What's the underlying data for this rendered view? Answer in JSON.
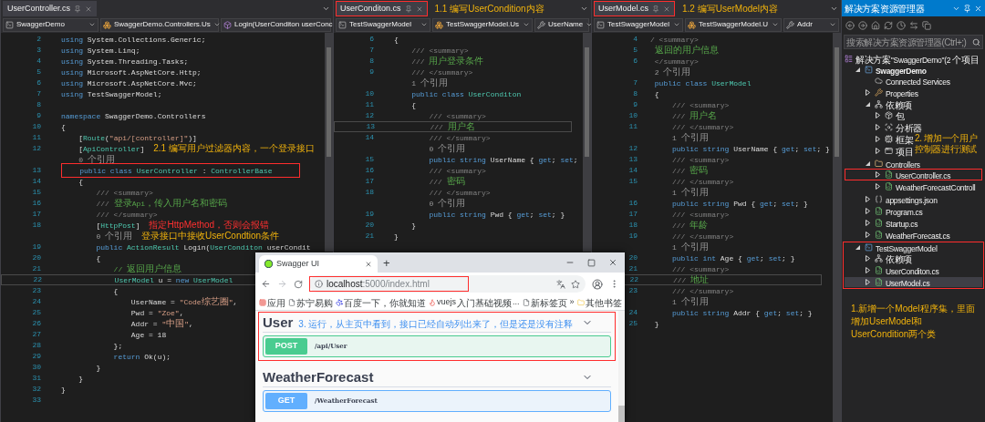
{
  "editors": [
    {
      "tab": {
        "label": "UserController.cs",
        "boxed": false
      },
      "nav": [
        {
          "label": "SwaggerDemo",
          "kind": "project"
        },
        {
          "label": "SwaggerDemo.Controllers.Us",
          "kind": "class"
        },
        {
          "label": "Login(UserConditon userConc",
          "kind": "method"
        }
      ],
      "lines": [
        {
          "kind": "code",
          "number": "2",
          "tokens": [
            {
              "kind": "kw",
              "text": "using"
            },
            {
              "kind": "plain",
              "text": " System.Collections.Generic;"
            }
          ]
        },
        {
          "kind": "code",
          "number": "3",
          "tokens": [
            {
              "kind": "kw",
              "text": "using"
            },
            {
              "kind": "plain",
              "text": " System.Linq;"
            }
          ]
        },
        {
          "kind": "code",
          "number": "4",
          "tokens": [
            {
              "kind": "kw",
              "text": "using"
            },
            {
              "kind": "plain",
              "text": " System.Threading.Tasks;"
            }
          ]
        },
        {
          "kind": "code",
          "number": "5",
          "tokens": [
            {
              "kind": "kw",
              "text": "using"
            },
            {
              "kind": "plain",
              "text": " Microsoft.AspNetCore.Http;"
            }
          ]
        },
        {
          "kind": "code",
          "number": "6",
          "tokens": [
            {
              "kind": "kw",
              "text": "using"
            },
            {
              "kind": "plain",
              "text": " Microsoft.AspNetCore.Mvc;"
            }
          ]
        },
        {
          "kind": "code",
          "number": "7",
          "tokens": [
            {
              "kind": "kw",
              "text": "using"
            },
            {
              "kind": "plain",
              "text": " TestSwaggerModel;"
            }
          ]
        },
        {
          "kind": "code",
          "number": "8"
        },
        {
          "kind": "code",
          "number": "9",
          "tokens": [
            {
              "kind": "kw",
              "text": "namespace"
            },
            {
              "kind": "plain",
              "text": " SwaggerDemo.Controllers"
            }
          ]
        },
        {
          "kind": "code",
          "number": "10",
          "tokens": [
            {
              "kind": "plain",
              "text": "{"
            }
          ]
        },
        {
          "kind": "code",
          "number": "11",
          "tokens": [
            {
              "kind": "plain",
              "text": "    ["
            },
            {
              "kind": "type",
              "text": "Route"
            },
            {
              "kind": "plain",
              "text": "("
            },
            {
              "kind": "str",
              "text": "\"api/[controller]\""
            },
            {
              "kind": "plain",
              "text": ")]"
            }
          ]
        },
        {
          "kind": "code",
          "number": "12",
          "tokens": [
            {
              "kind": "plain",
              "text": "    ["
            },
            {
              "kind": "type",
              "text": "ApiController"
            },
            {
              "kind": "plain",
              "text": "]"
            }
          ],
          "note": {
            "text": "2.1 编写用户过滤器内容，一个登录接口",
            "kind": "callout"
          }
        },
        {
          "kind": "lens",
          "text": "    0 个引用"
        },
        {
          "kind": "marked",
          "number": "13",
          "tokens": [
            {
              "kind": "kw",
              "text": "    public class "
            },
            {
              "kind": "type",
              "text": "UserController"
            },
            {
              "kind": "plain",
              "text": " : "
            },
            {
              "kind": "type",
              "text": "ControllerBase"
            }
          ]
        },
        {
          "kind": "code",
          "number": "14",
          "tokens": [
            {
              "kind": "plain",
              "text": "    {"
            }
          ]
        },
        {
          "kind": "code",
          "number": "15",
          "tokens": [
            {
              "kind": "doc",
              "text": "        /// <summary>"
            }
          ]
        },
        {
          "kind": "code",
          "number": "16",
          "tokens": [
            {
              "kind": "doc",
              "text": "        ///"
            },
            {
              "kind": "comment",
              "text": " 登录Api，传入用户名和密码"
            }
          ]
        },
        {
          "kind": "code",
          "number": "17",
          "tokens": [
            {
              "kind": "doc",
              "text": "        /// </summary>"
            }
          ]
        },
        {
          "kind": "code",
          "number": "18",
          "tokens": [
            {
              "kind": "plain",
              "text": "        ["
            },
            {
              "kind": "type",
              "text": "HttpPost"
            },
            {
              "kind": "plain",
              "text": "]"
            }
          ],
          "note": {
            "text": "指定HttpMethod，否则会报错",
            "kind": "warning"
          }
        },
        {
          "kind": "lens",
          "text": "        0 个引用",
          "note": {
            "text": "登录接口中接收UserCondtion条件",
            "kind": "callout"
          }
        },
        {
          "kind": "code",
          "number": "19",
          "tokens": [
            {
              "kind": "kw",
              "text": "        public "
            },
            {
              "kind": "type",
              "text": "ActionResult"
            },
            {
              "kind": "plain",
              "text": " Login("
            },
            {
              "kind": "type",
              "text": "UserConditon"
            },
            {
              "kind": "plain",
              "text": " userCondit"
            }
          ]
        },
        {
          "kind": "code",
          "number": "20",
          "tokens": [
            {
              "kind": "plain",
              "text": "        {"
            }
          ]
        },
        {
          "kind": "code",
          "number": "21",
          "tokens": [
            {
              "kind": "comment",
              "text": "            // 返回用户信息"
            }
          ]
        },
        {
          "kind": "current",
          "number": "22",
          "tokens": [
            {
              "kind": "type",
              "text": "            UserModel"
            },
            {
              "kind": "plain",
              "text": " u = "
            },
            {
              "kind": "kw",
              "text": "new "
            },
            {
              "kind": "type",
              "text": "UserModel"
            }
          ]
        },
        {
          "kind": "code",
          "number": "23",
          "tokens": [
            {
              "kind": "plain",
              "text": "            {"
            }
          ]
        },
        {
          "kind": "code",
          "number": "24",
          "tokens": [
            {
              "kind": "plain",
              "text": "                UserName = "
            },
            {
              "kind": "str",
              "text": "\"Code综艺圈\""
            },
            {
              "kind": "plain",
              "text": ","
            }
          ]
        },
        {
          "kind": "code",
          "number": "25",
          "tokens": [
            {
              "kind": "plain",
              "text": "                Pwd = "
            },
            {
              "kind": "str",
              "text": "\"Zoe\""
            },
            {
              "kind": "plain",
              "text": ","
            }
          ]
        },
        {
          "kind": "code",
          "number": "26",
          "tokens": [
            {
              "kind": "plain",
              "text": "                Addr = "
            },
            {
              "kind": "str",
              "text": "\"中国\""
            },
            {
              "kind": "plain",
              "text": ","
            }
          ]
        },
        {
          "kind": "code",
          "number": "27",
          "tokens": [
            {
              "kind": "plain",
              "text": "                Age = 18"
            }
          ]
        },
        {
          "kind": "code",
          "number": "28",
          "tokens": [
            {
              "kind": "plain",
              "text": "            };"
            }
          ]
        },
        {
          "kind": "code",
          "number": "29",
          "tokens": [
            {
              "kind": "kw",
              "text": "            return"
            },
            {
              "kind": "plain",
              "text": " Ok(u);"
            }
          ]
        },
        {
          "kind": "code",
          "number": "30",
          "tokens": [
            {
              "kind": "plain",
              "text": "        }"
            }
          ]
        },
        {
          "kind": "code",
          "number": "31",
          "tokens": [
            {
              "kind": "plain",
              "text": "    }"
            }
          ]
        },
        {
          "kind": "code",
          "number": "32",
          "tokens": [
            {
              "kind": "plain",
              "text": "}"
            }
          ]
        },
        {
          "kind": "code",
          "number": "33"
        }
      ]
    },
    {
      "tab": {
        "label": "UserConditon.cs",
        "boxed": true,
        "note": {
          "text": "1.1 编写UserCondition内容",
          "kind": "callout"
        }
      },
      "nav": [
        {
          "label": "TestSwaggerModel",
          "kind": "project"
        },
        {
          "label": "TestSwaggerModel.Us",
          "kind": "class"
        },
        {
          "label": "UserName",
          "kind": "property"
        }
      ],
      "lines": [
        {
          "kind": "code",
          "number": "6",
          "tokens": [
            {
              "kind": "plain",
              "text": "{"
            }
          ]
        },
        {
          "kind": "code",
          "number": "7",
          "tokens": [
            {
              "kind": "doc",
              "text": "    /// <summary>"
            }
          ]
        },
        {
          "kind": "code",
          "number": "8",
          "tokens": [
            {
              "kind": "doc",
              "text": "    ///"
            },
            {
              "kind": "comment",
              "text": " 用户登录条件"
            }
          ]
        },
        {
          "kind": "code",
          "number": "9",
          "tokens": [
            {
              "kind": "doc",
              "text": "    /// </summary>"
            }
          ]
        },
        {
          "kind": "lens",
          "text": "    1 个引用"
        },
        {
          "kind": "code",
          "number": "10",
          "tokens": [
            {
              "kind": "kw",
              "text": "    public class "
            },
            {
              "kind": "type",
              "text": "UserConditon"
            }
          ]
        },
        {
          "kind": "code",
          "number": "11",
          "tokens": [
            {
              "kind": "plain",
              "text": "    {"
            }
          ]
        },
        {
          "kind": "code",
          "number": "12",
          "tokens": [
            {
              "kind": "doc",
              "text": "        /// <summary>"
            }
          ]
        },
        {
          "kind": "current",
          "number": "13",
          "tokens": [
            {
              "kind": "doc",
              "text": "        ///"
            },
            {
              "kind": "comment",
              "text": " 用户名"
            }
          ]
        },
        {
          "kind": "code",
          "number": "14",
          "tokens": [
            {
              "kind": "doc",
              "text": "        /// </summary>"
            }
          ]
        },
        {
          "kind": "lens",
          "text": "        0 个引用"
        },
        {
          "kind": "code",
          "number": "15",
          "tokens": [
            {
              "kind": "kw",
              "text": "        public string "
            },
            {
              "kind": "plain",
              "text": "UserName { "
            },
            {
              "kind": "kw",
              "text": "get"
            },
            {
              "kind": "plain",
              "text": "; "
            },
            {
              "kind": "kw",
              "text": "set"
            },
            {
              "kind": "plain",
              "text": ";"
            }
          ]
        },
        {
          "kind": "code",
          "number": "16",
          "tokens": [
            {
              "kind": "doc",
              "text": "        /// <summary>"
            }
          ]
        },
        {
          "kind": "code",
          "number": "17",
          "tokens": [
            {
              "kind": "doc",
              "text": "        ///"
            },
            {
              "kind": "comment",
              "text": " 密码"
            }
          ]
        },
        {
          "kind": "code",
          "number": "18",
          "tokens": [
            {
              "kind": "doc",
              "text": "        /// </summary>"
            }
          ]
        },
        {
          "kind": "lens",
          "text": "        0 个引用"
        },
        {
          "kind": "code",
          "number": "19",
          "tokens": [
            {
              "kind": "kw",
              "text": "        public string "
            },
            {
              "kind": "plain",
              "text": "Pwd { "
            },
            {
              "kind": "kw",
              "text": "get"
            },
            {
              "kind": "plain",
              "text": "; "
            },
            {
              "kind": "kw",
              "text": "set"
            },
            {
              "kind": "plain",
              "text": "; }"
            }
          ]
        },
        {
          "kind": "code",
          "number": "20",
          "tokens": [
            {
              "kind": "plain",
              "text": "    }"
            }
          ]
        },
        {
          "kind": "code",
          "number": "21",
          "tokens": [
            {
              "kind": "plain",
              "text": "}"
            }
          ]
        }
      ]
    },
    {
      "tab": {
        "label": "UserModel.cs",
        "boxed": true,
        "note": {
          "text": "1.2 编写UserModel内容",
          "kind": "callout"
        }
      },
      "nav": [
        {
          "label": "TestSwaggerModel",
          "kind": "project"
        },
        {
          "label": "TestSwaggerModel.U",
          "kind": "class"
        },
        {
          "label": "Addr",
          "kind": "property"
        }
      ],
      "lines": [
        {
          "kind": "code",
          "number": "4",
          "tokens": [
            {
              "kind": "doc",
              "text": "/ <summary>"
            }
          ]
        },
        {
          "kind": "code",
          "number": "5",
          "tokens": [
            {
              "kind": "comment",
              "text": " 返回的用户信息"
            }
          ]
        },
        {
          "kind": "code",
          "number": "6",
          "tokens": [
            {
              "kind": "doc",
              "text": " </summary>"
            }
          ]
        },
        {
          "kind": "lens",
          "text": " 2 个引用"
        },
        {
          "kind": "code",
          "number": "7",
          "tokens": [
            {
              "kind": "kw",
              "text": " public class "
            },
            {
              "kind": "type",
              "text": "UserModel"
            }
          ]
        },
        {
          "kind": "code",
          "number": "8",
          "tokens": [
            {
              "kind": "plain",
              "text": " {"
            }
          ]
        },
        {
          "kind": "code",
          "number": "9",
          "tokens": [
            {
              "kind": "doc",
              "text": "     /// <summary>"
            }
          ]
        },
        {
          "kind": "code",
          "number": "10",
          "tokens": [
            {
              "kind": "doc",
              "text": "     ///"
            },
            {
              "kind": "comment",
              "text": " 用户名"
            }
          ]
        },
        {
          "kind": "code",
          "number": "11",
          "tokens": [
            {
              "kind": "doc",
              "text": "     /// </summary>"
            }
          ]
        },
        {
          "kind": "lens",
          "text": "     1 个引用"
        },
        {
          "kind": "code",
          "number": "12",
          "tokens": [
            {
              "kind": "kw",
              "text": "     public string "
            },
            {
              "kind": "plain",
              "text": "UserName { "
            },
            {
              "kind": "kw",
              "text": "get"
            },
            {
              "kind": "plain",
              "text": "; "
            },
            {
              "kind": "kw",
              "text": "set"
            },
            {
              "kind": "plain",
              "text": "; }"
            }
          ]
        },
        {
          "kind": "code",
          "number": "13",
          "tokens": [
            {
              "kind": "doc",
              "text": "     /// <summary>"
            }
          ]
        },
        {
          "kind": "code",
          "number": "14",
          "tokens": [
            {
              "kind": "doc",
              "text": "     ///"
            },
            {
              "kind": "comment",
              "text": " 密码"
            }
          ]
        },
        {
          "kind": "code",
          "number": "15",
          "tokens": [
            {
              "kind": "doc",
              "text": "     /// </summary>"
            }
          ]
        },
        {
          "kind": "lens",
          "text": "     1 个引用"
        },
        {
          "kind": "code",
          "number": "16",
          "tokens": [
            {
              "kind": "kw",
              "text": "     public string "
            },
            {
              "kind": "plain",
              "text": "Pwd { "
            },
            {
              "kind": "kw",
              "text": "get"
            },
            {
              "kind": "plain",
              "text": "; "
            },
            {
              "kind": "kw",
              "text": "set"
            },
            {
              "kind": "plain",
              "text": "; }"
            }
          ]
        },
        {
          "kind": "code",
          "number": "17",
          "tokens": [
            {
              "kind": "doc",
              "text": "     /// <summary>"
            }
          ]
        },
        {
          "kind": "code",
          "number": "18",
          "tokens": [
            {
              "kind": "doc",
              "text": "     ///"
            },
            {
              "kind": "comment",
              "text": " 年龄"
            }
          ]
        },
        {
          "kind": "code",
          "number": "19",
          "tokens": [
            {
              "kind": "doc",
              "text": "     /// </summary>"
            }
          ]
        },
        {
          "kind": "lens",
          "text": "     1 个引用"
        },
        {
          "kind": "code",
          "number": "20",
          "tokens": [
            {
              "kind": "kw",
              "text": "     public int "
            },
            {
              "kind": "plain",
              "text": "Age { "
            },
            {
              "kind": "kw",
              "text": "get"
            },
            {
              "kind": "plain",
              "text": "; "
            },
            {
              "kind": "kw",
              "text": "set"
            },
            {
              "kind": "plain",
              "text": "; }"
            }
          ]
        },
        {
          "kind": "code",
          "number": "21",
          "tokens": [
            {
              "kind": "doc",
              "text": "     /// <summary>"
            }
          ]
        },
        {
          "kind": "current",
          "number": "22",
          "tokens": [
            {
              "kind": "doc",
              "text": "     ///"
            },
            {
              "kind": "comment",
              "text": " 地址"
            }
          ]
        },
        {
          "kind": "code",
          "number": "23",
          "tokens": [
            {
              "kind": "doc",
              "text": "     /// </summary>"
            }
          ]
        },
        {
          "kind": "lens",
          "text": "     1 个引用"
        },
        {
          "kind": "code",
          "number": "24",
          "tokens": [
            {
              "kind": "kw",
              "text": "     public string "
            },
            {
              "kind": "plain",
              "text": "Addr { "
            },
            {
              "kind": "kw",
              "text": "get"
            },
            {
              "kind": "plain",
              "text": "; "
            },
            {
              "kind": "kw",
              "text": "set"
            },
            {
              "kind": "plain",
              "text": "; }"
            }
          ]
        },
        {
          "kind": "code",
          "number": "25",
          "tokens": [
            {
              "kind": "plain",
              "text": " }"
            }
          ]
        }
      ]
    }
  ],
  "explorer": {
    "title": "解决方案资源管理器",
    "search": {
      "placeholder": "搜索解决方案资源管理器(Ctrl+;)"
    },
    "tree": {
      "label": "解决方案\"SwaggerDemo\"(2 个项目",
      "kind": "solution",
      "selected": false,
      "boxed": false,
      "children": [
        {
          "label": "SwaggerDemo",
          "kind": "project",
          "bold": true,
          "expanded": true,
          "selected": false,
          "boxed": false,
          "children": [
            {
              "label": "Connected Services",
              "kind": "services",
              "selected": false,
              "boxed": false
            },
            {
              "label": "Properties",
              "kind": "properties",
              "expanded": false,
              "selected": false,
              "boxed": false
            },
            {
              "label": "依赖项",
              "kind": "dependencies",
              "expanded": true,
              "selected": false,
              "boxed": false,
              "children": [
                {
                  "label": "包",
                  "kind": "package",
                  "expanded": false,
                  "selected": false,
                  "boxed": false
                },
                {
                  "label": "分析器",
                  "kind": "analyzer",
                  "expanded": false,
                  "selected": false,
                  "boxed": false
                },
                {
                  "label": "框架",
                  "kind": "framework",
                  "expanded": false,
                  "selected": false,
                  "boxed": false,
                  "note": {
                    "text": "2. 增加一个用户控制器进行测试",
                    "kind": "callout"
                  }
                },
                {
                  "label": "项目",
                  "kind": "reference",
                  "expanded": false,
                  "selected": false,
                  "boxed": false
                }
              ]
            },
            {
              "label": "Controllers",
              "kind": "folder",
              "expanded": true,
              "selected": false,
              "boxed": false,
              "children": [
                {
                  "label": "UserController.cs",
                  "kind": "csharp",
                  "expanded": false,
                  "selected": false,
                  "boxed": true
                },
                {
                  "label": "WeatherForecastControll",
                  "kind": "csharp",
                  "expanded": false,
                  "selected": false,
                  "boxed": false
                }
              ]
            },
            {
              "label": "appsettings.json",
              "kind": "json",
              "expanded": false,
              "selected": false,
              "boxed": false
            },
            {
              "label": "Program.cs",
              "kind": "csharp",
              "expanded": false,
              "selected": false,
              "boxed": false
            },
            {
              "label": "Startup.cs",
              "kind": "csharp",
              "expanded": false,
              "selected": false,
              "boxed": false
            },
            {
              "label": "WeatherForecast.cs",
              "kind": "csharp",
              "expanded": false,
              "selected": false,
              "boxed": false
            }
          ]
        },
        {
          "label": "TestSwaggerModel",
          "kind": "project",
          "bold": false,
          "expanded": true,
          "selected": false,
          "boxed": true,
          "children": [
            {
              "label": "依赖项",
              "kind": "dependencies",
              "expanded": false,
              "selected": false,
              "boxed": false
            },
            {
              "label": "UserConditon.cs",
              "kind": "csharp",
              "expanded": false,
              "selected": false,
              "boxed": false
            },
            {
              "label": "UserModel.cs",
              "kind": "csharp",
              "expanded": false,
              "selected": true,
              "boxed": false
            }
          ]
        }
      ]
    },
    "note": {
      "text": "1.新增一个Model程序集，里面增加UserModel和UserCondition两个类",
      "kind": "callout"
    }
  },
  "browser": {
    "tab": {
      "title": "Swagger UI"
    },
    "new_tab": "+",
    "url": {
      "host": "localhost",
      "rest": ":5000/index.html",
      "boxed": true
    },
    "bookmarks": [
      {
        "label": "应用",
        "kind": "apps"
      },
      {
        "label": "苏宁易购",
        "kind": "page"
      },
      {
        "label": "百度一下，你就知道",
        "kind": "paw"
      },
      {
        "label": "vuejs入门基础视频...",
        "kind": "flame"
      },
      {
        "label": "新标签页",
        "kind": "page"
      }
    ],
    "overflow": "»",
    "other": {
      "label": "其他书签",
      "kind": "folder"
    },
    "sections": [
      {
        "title": "User",
        "boxed": true,
        "note": {
          "text": "3. 运行，从主页中看到，接口已经自动列出来了，但是还是没有注释",
          "kind": "info"
        },
        "operations": [
          {
            "method": "POST",
            "path": "/api/User"
          }
        ]
      },
      {
        "title": "WeatherForecast",
        "boxed": false,
        "operations": [
          {
            "method": "GET",
            "path": "/WeatherForecast"
          }
        ]
      }
    ]
  }
}
